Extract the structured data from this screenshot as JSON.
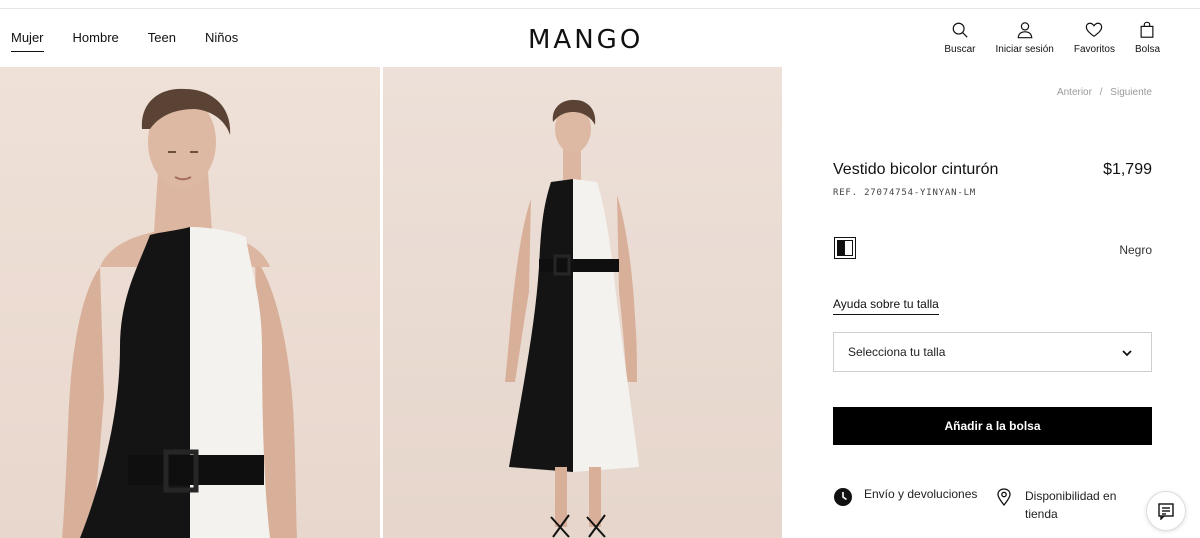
{
  "header": {
    "brand": "MANGO",
    "nav": [
      {
        "label": "Mujer",
        "active": true
      },
      {
        "label": "Hombre",
        "active": false
      },
      {
        "label": "Teen",
        "active": false
      },
      {
        "label": "Niños",
        "active": false
      }
    ],
    "tools": {
      "search": {
        "label": "Buscar",
        "icon": "search-icon"
      },
      "account": {
        "label": "Iniciar sesión",
        "icon": "user-icon"
      },
      "favorites": {
        "label": "Favoritos",
        "icon": "heart-icon"
      },
      "bag": {
        "label": "Bolsa",
        "icon": "bag-icon"
      }
    }
  },
  "product": {
    "prev": "Anterior",
    "separator": "/",
    "next": "Siguiente",
    "title": "Vestido bicolor cinturón",
    "price": "$1,799",
    "ref": "REF. 27074754-YINYAN-LM",
    "color": {
      "name": "Negro",
      "swatch_colors": [
        "#111111",
        "#ffffff"
      ]
    },
    "size_help": "Ayuda sobre tu talla",
    "size_select": "Selecciona tu talla",
    "add_to_bag": "Añadir a la bolsa",
    "shipping": "Envío y devoluciones",
    "availability": "Disponibilidad en tienda"
  },
  "colors": {
    "accent": "#000000",
    "photo_background": "#ecdcd3"
  }
}
